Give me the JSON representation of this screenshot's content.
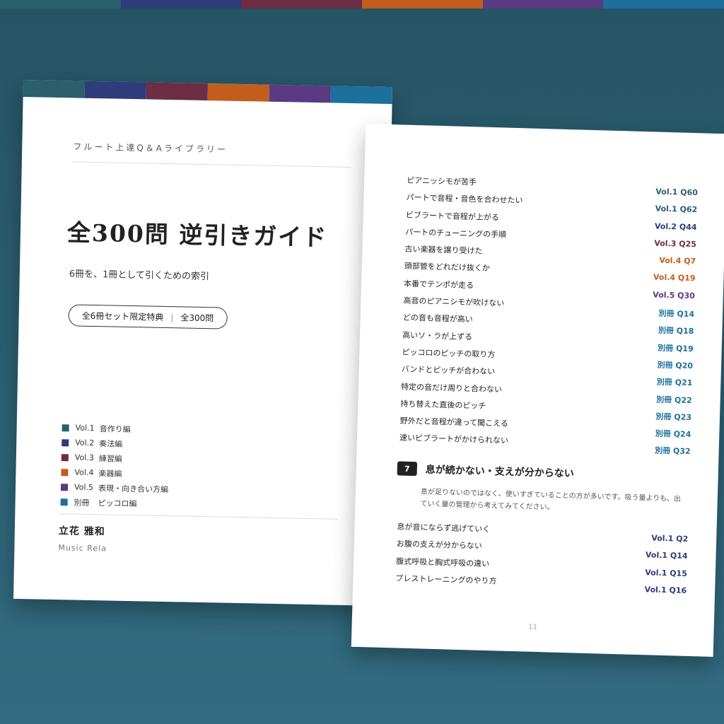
{
  "colors": {
    "vol1": "#2a5f6b",
    "vol2": "#2e3c79",
    "vol3": "#6c2d45",
    "vol4": "#c25d1e",
    "vol5": "#5a3a82",
    "extra": "#1d6f9c",
    "background": "#2c6073"
  },
  "cover": {
    "series": "フルート上達Q＆Aライブラリー",
    "title": "全300問 逆引きガイド",
    "subtitle": "6冊を、1冊として引くための索引",
    "badge": {
      "left": "全6冊セット限定特典",
      "sep": "|",
      "right": "全300問"
    },
    "volumes": [
      {
        "vol": "Vol.1",
        "label": "音作り編",
        "color_key": "vol1"
      },
      {
        "vol": "Vol.2",
        "label": "奏法編",
        "color_key": "vol2"
      },
      {
        "vol": "Vol.3",
        "label": "練習編",
        "color_key": "vol3"
      },
      {
        "vol": "Vol.4",
        "label": "楽器編",
        "color_key": "vol4"
      },
      {
        "vol": "Vol.5",
        "label": "表現・向き合い方編",
        "color_key": "vol5"
      },
      {
        "vol": "別冊",
        "label": "ピッコロ編",
        "color_key": "extra"
      }
    ],
    "author": "立花 雅和",
    "publisher": "Music Rela"
  },
  "index_page": {
    "entries": [
      {
        "q": "ピアニッシモが苦手",
        "ref": "Vol.1 Q60",
        "color_key": "vol1"
      },
      {
        "q": "パートで音程・音色を合わせたい",
        "ref": "Vol.1 Q62",
        "color_key": "vol1"
      },
      {
        "q": "ビブラートで音程が上がる",
        "ref": "Vol.2 Q44",
        "color_key": "vol2"
      },
      {
        "q": "パートのチューニングの手順",
        "ref": "Vol.3 Q25",
        "color_key": "vol3"
      },
      {
        "q": "古い楽器を譲り受けた",
        "ref": "Vol.4 Q7",
        "color_key": "vol4"
      },
      {
        "q": "頭部管をどれだけ抜くか",
        "ref": "Vol.4 Q19",
        "color_key": "vol4"
      },
      {
        "q": "本番でテンポが走る",
        "ref": "Vol.5 Q30",
        "color_key": "vol5"
      },
      {
        "q": "高音のピアニシモが吹けない",
        "ref": "別冊 Q14",
        "color_key": "extra"
      },
      {
        "q": "どの音も音程が高い",
        "ref": "別冊 Q18",
        "color_key": "extra"
      },
      {
        "q": "高いソ・ラが上ずる",
        "ref": "別冊 Q19",
        "color_key": "extra"
      },
      {
        "q": "ピッコロのピッチの取り方",
        "ref": "別冊 Q20",
        "color_key": "extra"
      },
      {
        "q": "バンドとピッチが合わない",
        "ref": "別冊 Q21",
        "color_key": "extra"
      },
      {
        "q": "特定の音だけ周りと合わない",
        "ref": "別冊 Q22",
        "color_key": "extra"
      },
      {
        "q": "持ち替えた直後のピッチ",
        "ref": "別冊 Q23",
        "color_key": "extra"
      },
      {
        "q": "野外だと音程が違って聞こえる",
        "ref": "別冊 Q24",
        "color_key": "extra"
      },
      {
        "q": "速いビブラートがかけられない",
        "ref": "別冊 Q32",
        "color_key": "extra"
      }
    ],
    "section": {
      "number": "7",
      "title": "息が続かない・支えが分からない",
      "desc": "息が足りないのではなく、使いすぎていることの方が多いです。吸う量よりも、出ていく量の管理から考えてみてください。"
    },
    "section_entries": [
      {
        "q": "息が音にならず逃げていく",
        "ref": "Vol.1 Q2",
        "color_key": "vol2"
      },
      {
        "q": "お腹の支えが分からない",
        "ref": "Vol.1 Q14",
        "color_key": "vol2"
      },
      {
        "q": "腹式呼吸と胸式呼吸の違い",
        "ref": "Vol.1 Q15",
        "color_key": "vol2"
      },
      {
        "q": "ブレストレーニングのやり方",
        "ref": "Vol.1 Q16",
        "color_key": "vol2"
      }
    ],
    "page_number": "11"
  }
}
